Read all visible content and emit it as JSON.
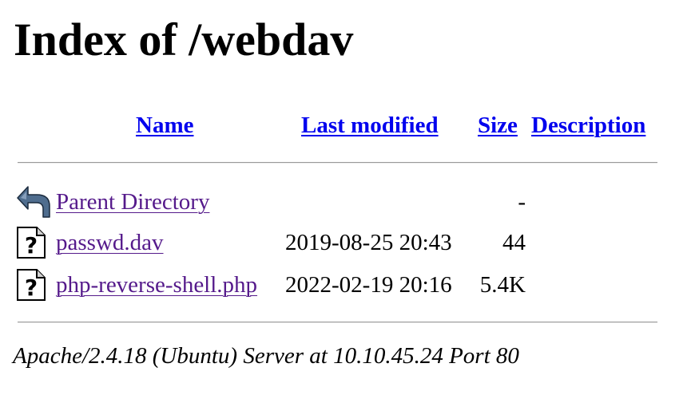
{
  "page": {
    "title": "Index of /webdav"
  },
  "table": {
    "headers": {
      "name": "Name",
      "last_modified": "Last modified",
      "size": "Size",
      "description": "Description"
    },
    "rows": [
      {
        "icon": "back-icon",
        "name": "Parent Directory",
        "last_modified": "",
        "size": "-",
        "description": ""
      },
      {
        "icon": "unknown-file-icon",
        "name": "passwd.dav",
        "last_modified": "2019-08-25 20:43",
        "size": "44",
        "description": ""
      },
      {
        "icon": "unknown-file-icon",
        "name": "php-reverse-shell.php",
        "last_modified": "2022-02-19 20:16",
        "size": "5.4K",
        "description": ""
      }
    ]
  },
  "footer": {
    "address": "Apache/2.4.18 (Ubuntu) Server at 10.10.45.24 Port 80"
  },
  "colors": {
    "link": "#0000ee",
    "visited_link": "#551a8b",
    "text": "#000000",
    "background": "#ffffff"
  }
}
